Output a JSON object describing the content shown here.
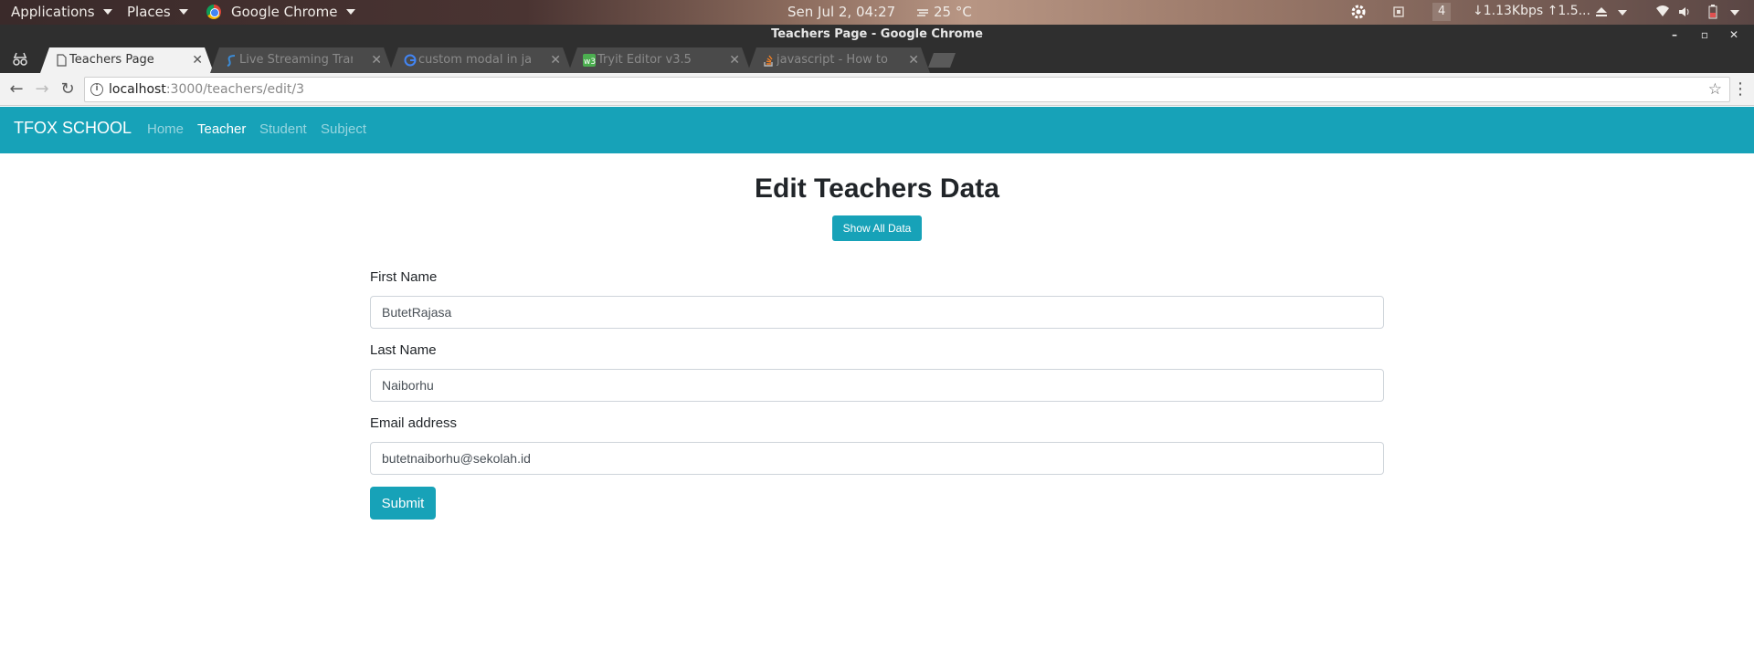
{
  "system_bar": {
    "applications": "Applications",
    "places": "Places",
    "active_app": "Google Chrome",
    "datetime": "Sen Jul  2, 04:27",
    "weather": "25 °C",
    "workspace": "4",
    "network_speed": "↓1.13Kbps ↑1.5..."
  },
  "window": {
    "title": "Teachers Page - Google Chrome"
  },
  "tabs": [
    {
      "title": "Teachers Page",
      "icon": "page-icon"
    },
    {
      "title": "Live Streaming Trans T",
      "icon": "s-logo-icon"
    },
    {
      "title": "custom modal in javasc",
      "icon": "google-g-icon"
    },
    {
      "title": "Tryit Editor v3.5",
      "icon": "w3-icon"
    },
    {
      "title": "javascript - How to crea",
      "icon": "stackoverflow-icon"
    }
  ],
  "address_bar": {
    "host": "localhost",
    "path": ":3000/teachers/edit/3"
  },
  "navbar": {
    "brand": "TFOX SCHOOL",
    "links": [
      "Home",
      "Teacher",
      "Student",
      "Subject"
    ],
    "active": "Teacher"
  },
  "page": {
    "title": "Edit Teachers Data",
    "show_all_label": "Show All Data"
  },
  "form": {
    "first_name_label": "First Name",
    "first_name_value": "ButetRajasa",
    "last_name_label": "Last Name",
    "last_name_value": "Naiborhu",
    "email_label": "Email address",
    "email_value": "butetnaiborhu@sekolah.id",
    "submit_label": "Submit"
  },
  "colors": {
    "accent": "#17a2b8"
  }
}
